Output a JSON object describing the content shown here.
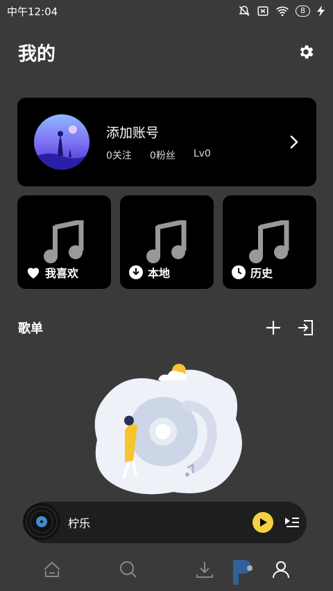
{
  "status_bar": {
    "time": "中午12:04",
    "battery": "8"
  },
  "header": {
    "title": "我的",
    "settings_icon": "gear-icon"
  },
  "account": {
    "name": "添加账号",
    "following": "0关注",
    "followers": "0粉丝",
    "level": "Lv0"
  },
  "tiles": [
    {
      "label": "我喜欢",
      "icon": "heart-icon"
    },
    {
      "label": "本地",
      "icon": "download-circle-icon"
    },
    {
      "label": "历史",
      "icon": "clock-icon"
    }
  ],
  "playlist": {
    "title": "歌单"
  },
  "player": {
    "song_title": "柠乐"
  },
  "colors": {
    "background": "#3a3a3a",
    "card": "#000000",
    "accent": "#f5d142"
  }
}
